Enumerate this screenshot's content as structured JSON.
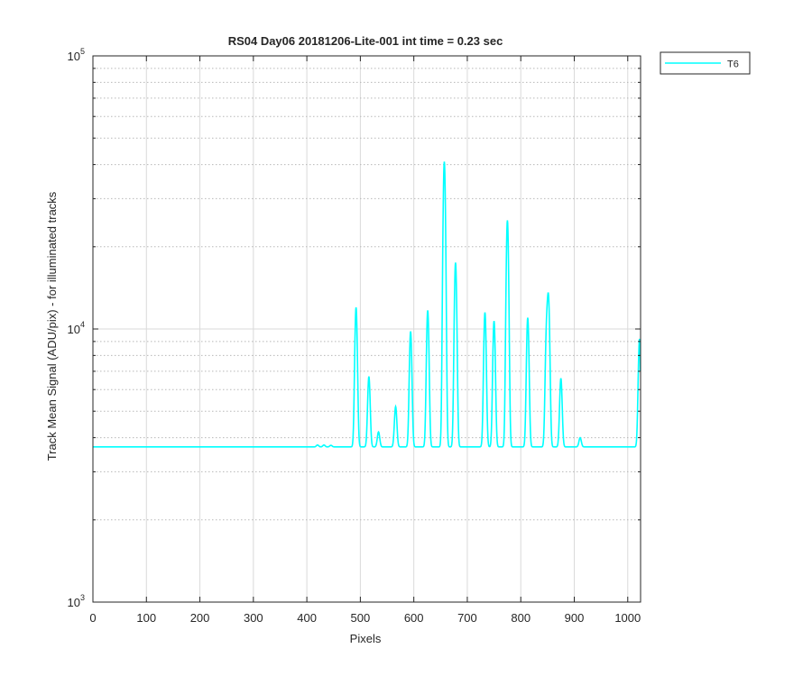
{
  "chart_data": {
    "type": "line",
    "title": "RS04 Day06 20181206-Lite-001 int time = 0.23 sec",
    "xlabel": "Pixels",
    "ylabel": "Track Mean Signal (ADU/pix) - for illuminated tracks",
    "xlim": [
      0,
      1024
    ],
    "ylim": [
      1000,
      100000
    ],
    "yscale": "log",
    "grid": true,
    "legend_position": "outside-top-right",
    "x_ticks": [
      "0",
      "100",
      "200",
      "300",
      "400",
      "500",
      "600",
      "700",
      "800",
      "900",
      "1000"
    ],
    "y_ticks": [
      {
        "base": "10",
        "exp": "3",
        "value": 1000
      },
      {
        "base": "10",
        "exp": "4",
        "value": 10000
      },
      {
        "base": "10",
        "exp": "5",
        "value": 100000
      }
    ],
    "baseline": 3700,
    "peaks": [
      {
        "x": 420,
        "y": 3760
      },
      {
        "x": 432,
        "y": 3760
      },
      {
        "x": 445,
        "y": 3750
      },
      {
        "x": 492,
        "y": 12000
      },
      {
        "x": 516,
        "y": 6700
      },
      {
        "x": 534,
        "y": 4200
      },
      {
        "x": 566,
        "y": 5200
      },
      {
        "x": 594,
        "y": 9800
      },
      {
        "x": 626,
        "y": 11700
      },
      {
        "x": 657,
        "y": 41000
      },
      {
        "x": 678,
        "y": 17500
      },
      {
        "x": 733,
        "y": 11500
      },
      {
        "x": 750,
        "y": 10700
      },
      {
        "x": 775,
        "y": 25000
      },
      {
        "x": 813,
        "y": 11000
      },
      {
        "x": 848,
        "y": 9200
      },
      {
        "x": 852,
        "y": 12200
      },
      {
        "x": 875,
        "y": 6600
      },
      {
        "x": 911,
        "y": 4000
      },
      {
        "x": 1022,
        "y": 9200
      }
    ],
    "series": [
      {
        "name": "T6",
        "color": "#00FFFF"
      }
    ]
  }
}
